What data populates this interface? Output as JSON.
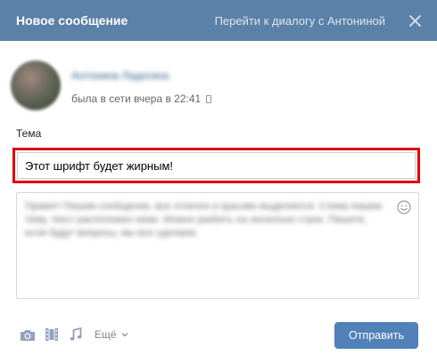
{
  "header": {
    "title": "Новое сообщение",
    "dialog_link": "Перейти к диалогу с Антониной",
    "close_icon": "close-icon"
  },
  "recipient": {
    "name": "Антонина Ладогина",
    "status": "была в сети вчера в 22:41",
    "device_icon": "mobile-phone-icon"
  },
  "subject": {
    "label": "Тема",
    "value": "Этот шрифт будет жирным!"
  },
  "message": {
    "text": "Привет! Пишем сообщение, все отлично и красиво выделяется. Слева пишем тему, текст расположен ниже. Можно разбить на несколько строк. Пишите, если будут вопросы, мы все сделаем.",
    "emoji_icon": "smile-icon"
  },
  "toolbar": {
    "photo_icon": "camera-icon",
    "video_icon": "film-icon",
    "audio_icon": "music-note-icon",
    "more_label": "Ещё",
    "send_label": "Отправить"
  },
  "colors": {
    "header_bg": "#5b81a8",
    "highlight": "#e00000",
    "send_button": "#5181b8"
  }
}
